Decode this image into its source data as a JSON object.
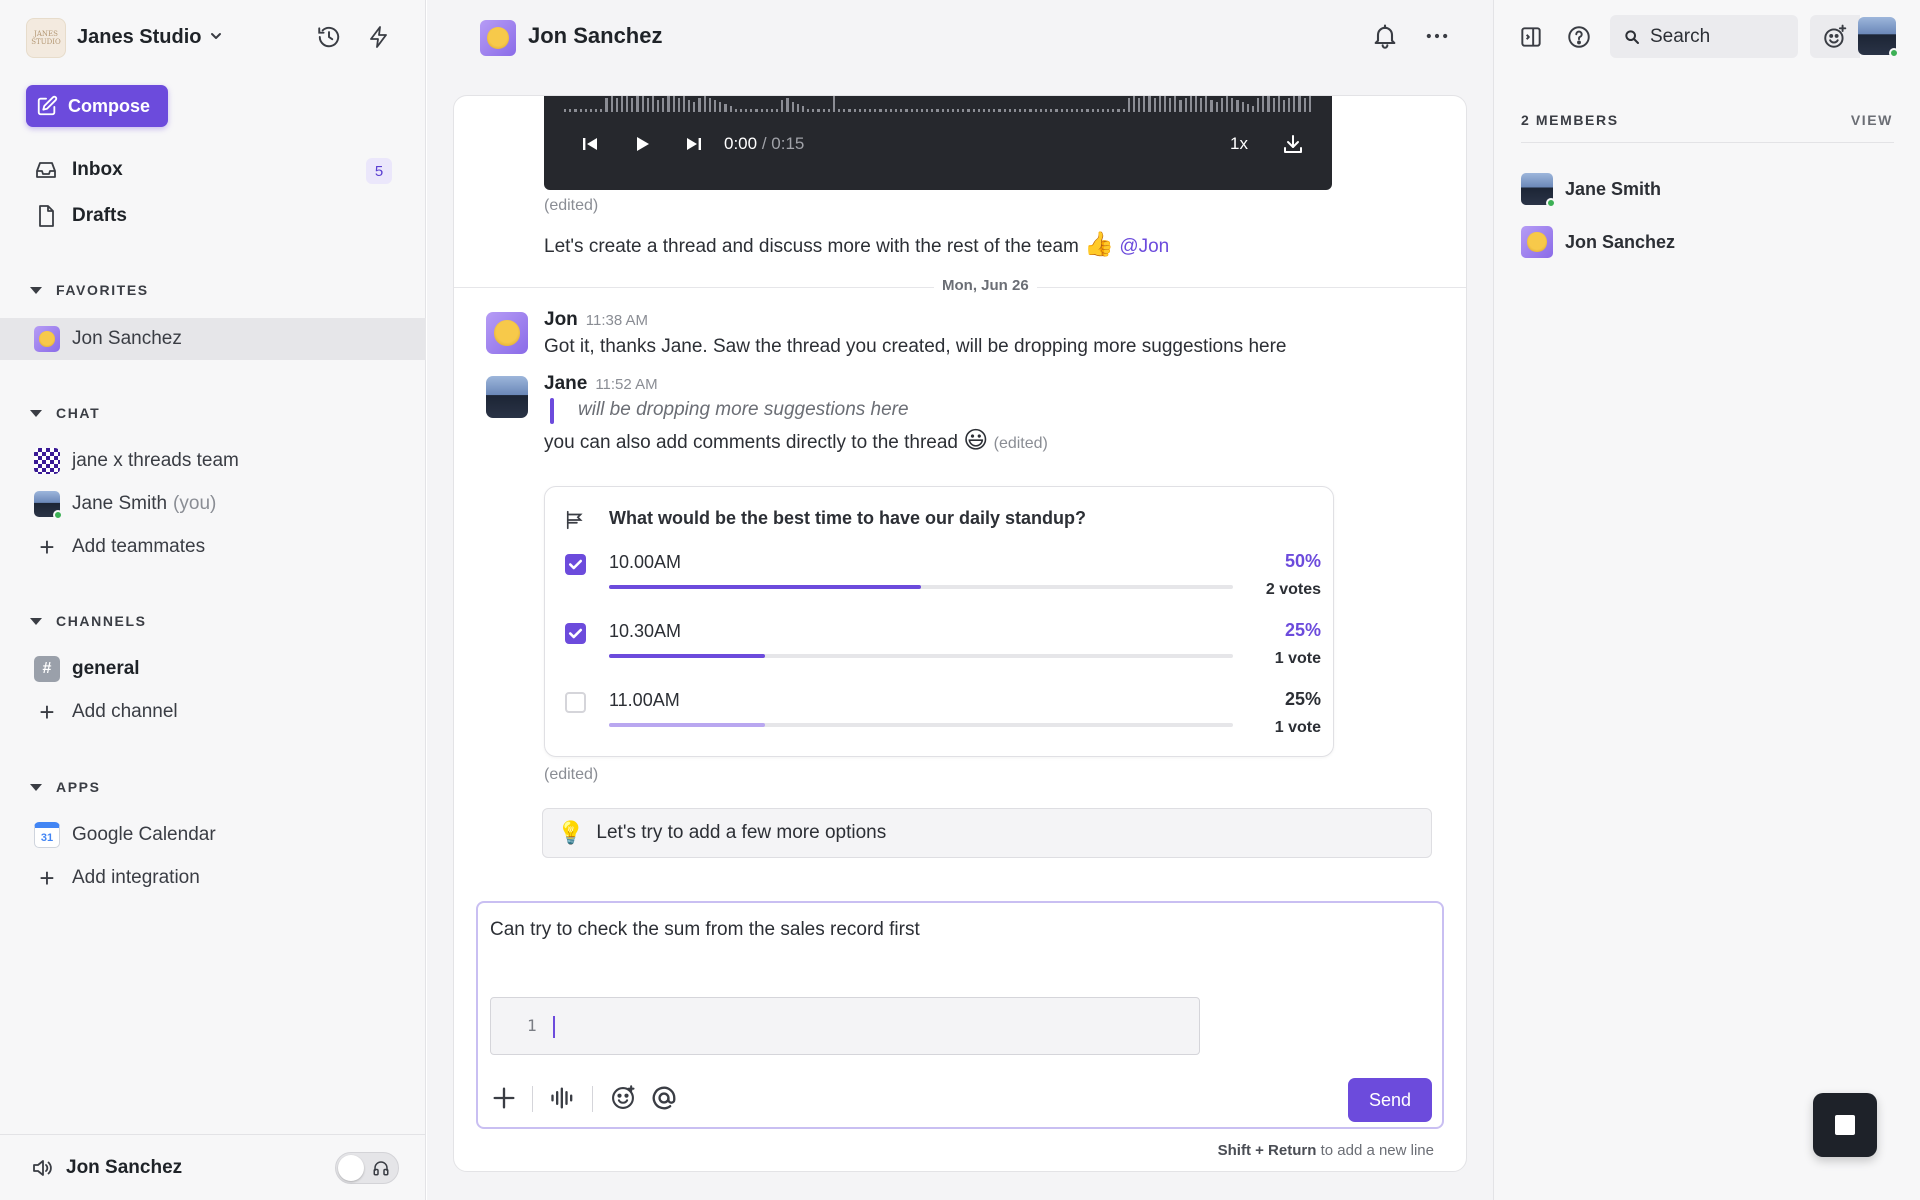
{
  "sidebar": {
    "workspace_name": "Janes Studio",
    "workspace_logo_text": "JANES STUDIO",
    "compose_label": "Compose",
    "inbox_label": "Inbox",
    "inbox_count": "5",
    "drafts_label": "Drafts",
    "favorites_heading": "FAVORITES",
    "favorites": [
      {
        "label": "Jon Sanchez"
      }
    ],
    "chat_heading": "CHAT",
    "chats": [
      {
        "label": "jane x threads team"
      },
      {
        "label": "Jane Smith",
        "suffix": "(you)"
      }
    ],
    "add_teammates_label": "Add teammates",
    "channels_heading": "CHANNELS",
    "channels": [
      {
        "label": "general"
      }
    ],
    "add_channel_label": "Add channel",
    "apps_heading": "APPS",
    "apps": [
      {
        "label": "Google Calendar",
        "icon_text": "31"
      }
    ],
    "add_integration_label": "Add integration",
    "footer_user": "Jon Sanchez"
  },
  "conversation": {
    "title": "Jon Sanchez",
    "audio": {
      "current": "0:00",
      "total": "/ 0:15",
      "speed": "1x",
      "progress": 0
    },
    "edited_label": "(edited)",
    "message_text": "Let's create a thread and discuss more with the rest of the team",
    "mention": "@Jon",
    "date_divider": "Mon, Jun 26",
    "messages": [
      {
        "author": "Jon",
        "time": "11:38 AM",
        "text": "Got it, thanks Jane. Saw the thread you created, will be dropping more suggestions here"
      },
      {
        "author": "Jane",
        "time": "11:52 AM",
        "quote": "will be dropping more suggestions here",
        "text": "you can also add comments directly to the thread"
      }
    ],
    "poll": {
      "question": "What would be the best time to have our daily standup?",
      "options": [
        {
          "label": "10.00AM",
          "percent": "50%",
          "votes": "2 votes",
          "checked": true,
          "fraction": 0.5
        },
        {
          "label": "10.30AM",
          "percent": "25%",
          "votes": "1 vote",
          "checked": true,
          "fraction": 0.25
        },
        {
          "label": "11.00AM",
          "percent": "25%",
          "votes": "1 vote",
          "checked": false,
          "fraction": 0.25
        }
      ]
    },
    "poll_edited_label": "(edited)",
    "tip_text": "Let's try to add a few more options",
    "composer": {
      "text": "Can try to check the sum from the sales record first",
      "code_line_number": "1",
      "send_label": "Send",
      "hint_keys": "Shift + Return",
      "hint_text": "to add a new line"
    }
  },
  "right_panel": {
    "search_label": "Search",
    "members_heading": "2 MEMBERS",
    "view_label": "VIEW",
    "members": [
      {
        "name": "Jane Smith"
      },
      {
        "name": "Jon Sanchez"
      }
    ]
  },
  "colors": {
    "accent": "#6c4bdc",
    "accent_light": "#b9a7f0",
    "online": "#3cb055"
  }
}
